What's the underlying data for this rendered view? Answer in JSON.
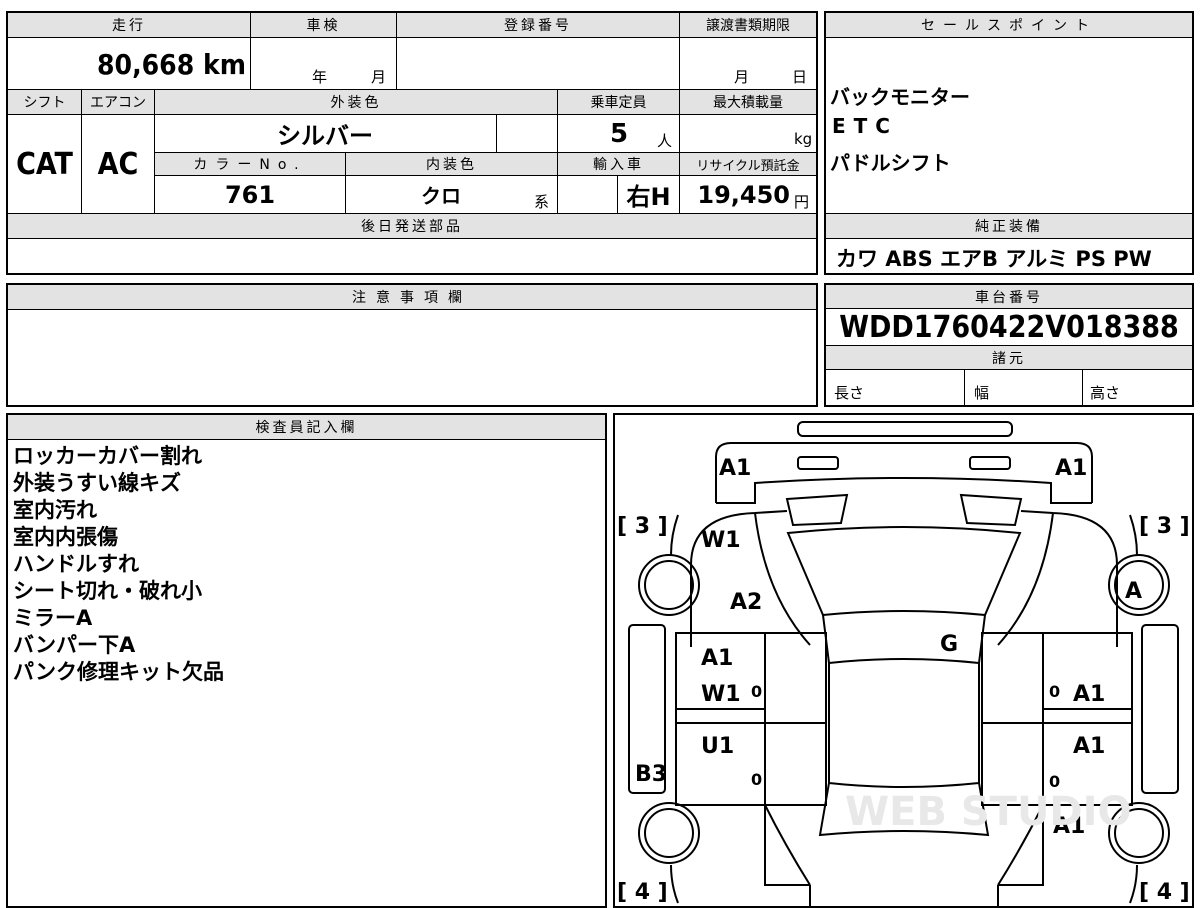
{
  "top": {
    "h_mileage": "走行",
    "mileage": "80,668 km",
    "h_inspection": "車検",
    "insp_year": "年",
    "insp_month": "月",
    "h_regno": "登録番号",
    "regno": "",
    "h_transfer": "譲渡書類期限",
    "tr_month": "月",
    "tr_day": "日",
    "h_shift": "シフト",
    "shift": "CAT",
    "h_ac": "エアコン",
    "ac": "AC",
    "h_exterior": "外装色",
    "exterior": "シルバー",
    "h_capacity": "乗車定員",
    "capacity": "5",
    "capacity_unit": "人",
    "h_maxload": "最大積載量",
    "maxload_unit": "kg",
    "h_colorno": "カラーNo.",
    "colorno": "761",
    "h_interior": "内装色",
    "interior": "クロ",
    "interior_suffix": "系",
    "h_import": "輸入車",
    "import": "右H",
    "h_recycle": "リサイクル預託金",
    "recycle": "19,450",
    "recycle_unit": "円",
    "h_parts": "後日発送部品"
  },
  "sales_points": {
    "header": "セールスポイント",
    "items": [
      "バックモニター",
      "ETC",
      "パドルシフト"
    ]
  },
  "equipment": {
    "header": "純正装備",
    "value": "カワ ABS エアB アルミ PS PW"
  },
  "caution": {
    "header": "注意事項欄"
  },
  "chassis": {
    "header": "車台番号",
    "value": "WDD1760422V018388"
  },
  "specs": {
    "header": "諸元",
    "length": "長さ",
    "width": "幅",
    "height": "高さ"
  },
  "inspector": {
    "header": "検査員記入欄",
    "notes": [
      "ロッカーカバー割れ",
      "外装うすい線キズ",
      "室内汚れ",
      "室内内張傷",
      "ハンドルすれ",
      "シート切れ・破れ小",
      "ミラーA",
      "バンパー下A",
      "パンク修理キット欠品"
    ]
  },
  "diagram": {
    "marks": {
      "front_left": "A1",
      "front_right": "A1",
      "tire_fl": "[ 3 ]",
      "tire_fr": "[ 3 ]",
      "tire_rl": "[ 4 ]",
      "tire_rr": "[ 4 ]",
      "fender_left": "W1",
      "hood_left": "A2",
      "wheel_right": "A",
      "roof": "G",
      "fdoor_left_1": "A1",
      "fdoor_left_2": "W1",
      "rdoor_left": "U1",
      "rocker_left": "B3",
      "fdoor_right": "A1",
      "rdoor_right": "A1",
      "rear_right": "A1",
      "zero_1": "0",
      "zero_2": "0",
      "zero_3": "0",
      "zero_4": "0"
    },
    "watermark": "WEB STUDIO"
  }
}
